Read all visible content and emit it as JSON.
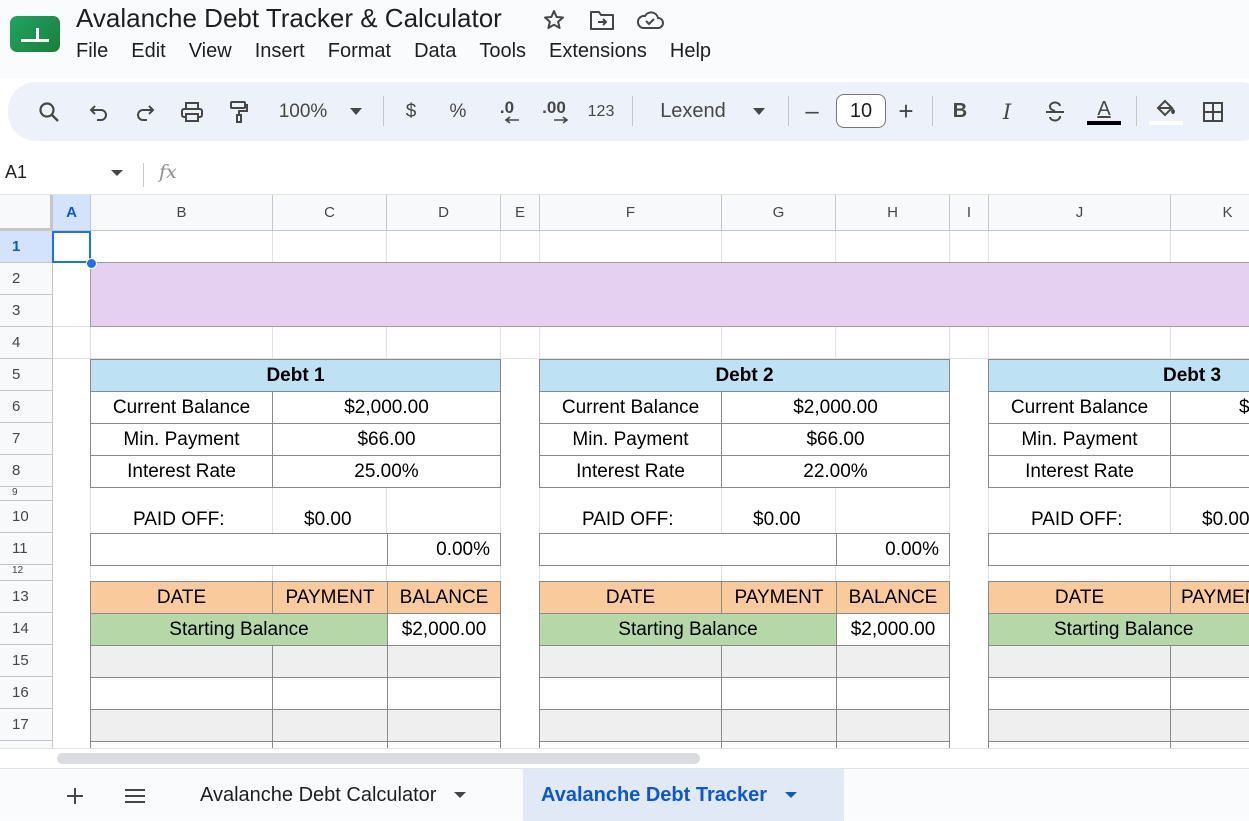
{
  "app": {
    "title": "Avalanche Debt Tracker & Calculator",
    "menu": [
      "File",
      "Edit",
      "View",
      "Insert",
      "Format",
      "Data",
      "Tools",
      "Extensions",
      "Help"
    ]
  },
  "toolbar": {
    "zoom": "100%",
    "currency": "$",
    "percent": "%",
    "decrease_decimal": ".0",
    "increase_decimal": ".00",
    "more_formats": "123",
    "font": "Lexend",
    "font_size": "10",
    "minus": "–",
    "plus": "+",
    "bold": "B",
    "italic": "I",
    "text_color": "A"
  },
  "formula_bar": {
    "cell_ref": "A1",
    "fx": "fx"
  },
  "columns": [
    "A",
    "B",
    "C",
    "D",
    "E",
    "F",
    "G",
    "H",
    "I",
    "J",
    "K"
  ],
  "rows": [
    "1",
    "2",
    "3",
    "4",
    "5",
    "6",
    "7",
    "8",
    "9",
    "10",
    "11",
    "12",
    "13",
    "14",
    "15",
    "16",
    "17"
  ],
  "debts": [
    {
      "title": "Debt 1",
      "balance_label": "Current Balance",
      "balance": "$2,000.00",
      "min_label": "Min. Payment",
      "min": "$66.00",
      "rate_label": "Interest Rate",
      "rate": "25.00%",
      "paid_label": "PAID OFF:",
      "paid": "$0.00",
      "progress": "0.00%",
      "col_date": "DATE",
      "col_payment": "PAYMENT",
      "col_balance": "BALANCE",
      "start_label": "Starting Balance",
      "start_balance": "$2,000.00"
    },
    {
      "title": "Debt 2",
      "balance_label": "Current Balance",
      "balance": "$2,000.00",
      "min_label": "Min. Payment",
      "min": "$66.00",
      "rate_label": "Interest Rate",
      "rate": "22.00%",
      "paid_label": "PAID OFF:",
      "paid": "$0.00",
      "progress": "0.00%",
      "col_date": "DATE",
      "col_payment": "PAYMENT",
      "col_balance": "BALANCE",
      "start_label": "Starting Balance",
      "start_balance": "$2,000.00"
    },
    {
      "title": "Debt 3",
      "balance_label": "Current Balance",
      "balance": "$",
      "min_label": "Min. Payment",
      "rate_label": "Interest Rate",
      "paid_label": "PAID OFF:",
      "paid": "$0.00",
      "col_date": "DATE",
      "col_payment": "PAYMENT",
      "start_label": "Starting Balance"
    }
  ],
  "sheets": {
    "tab1": "Avalanche Debt Calculator",
    "tab2": "Avalanche Debt Tracker"
  },
  "colors": {
    "banner": "#e6d0f2",
    "debt_header": "#bfe1f4",
    "table_header": "#f9cb9c",
    "starting_row": "#b6d7a8",
    "accent": "#0b57d0"
  }
}
